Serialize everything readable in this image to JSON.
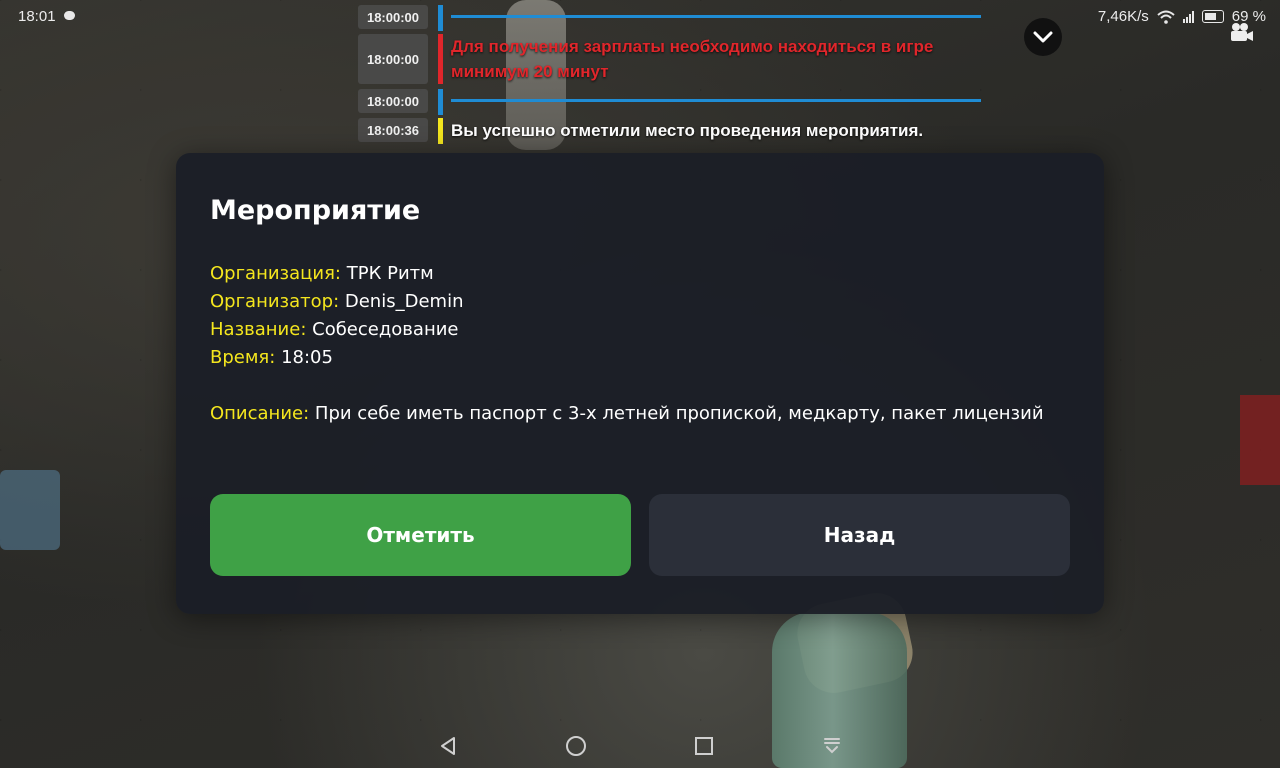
{
  "status_bar": {
    "time": "18:01",
    "net_speed": "7,46K/s",
    "battery_pct": "69 %"
  },
  "chat": {
    "rows": [
      {
        "time": "18:00:00",
        "text": "",
        "color": "#1f8cd4"
      },
      {
        "time": "18:00:00",
        "text": "Для получения зарплаты необходимо находиться в игре\nминимум 20 минут",
        "color": "#e0262b"
      },
      {
        "time": "18:00:00",
        "text": "",
        "color": "#1f8cd4"
      },
      {
        "time": "18:00:36",
        "text": "Вы успешно отметили место проведения мероприятия.",
        "color": "#f4e61e"
      }
    ]
  },
  "modal": {
    "title": "Мероприятие",
    "organization_label": "Организация:",
    "organization": "ТРК Ритм",
    "organizer_label": "Организатор:",
    "organizer": "Denis_Demin",
    "name_label": "Название:",
    "name": "Собеседование",
    "time_label": "Время:",
    "time": "18:05",
    "description_label": "Описание:",
    "description": "При себе иметь паспорт с 3-х летней пропиской, медкарту, пакет лицензий",
    "mark_button": "Отметить",
    "back_button": "Назад"
  },
  "colors": {
    "accent_green": "#3fa146",
    "label_yellow": "#f4e61e",
    "modal_bg": "#1b1e26"
  },
  "icons": [
    "message-icon",
    "wifi-icon",
    "signal-icon",
    "battery-icon",
    "chevron-down-icon",
    "camera-icon",
    "back-triangle-icon",
    "home-circle-icon",
    "recents-square-icon",
    "keyboard-collapse-icon"
  ]
}
